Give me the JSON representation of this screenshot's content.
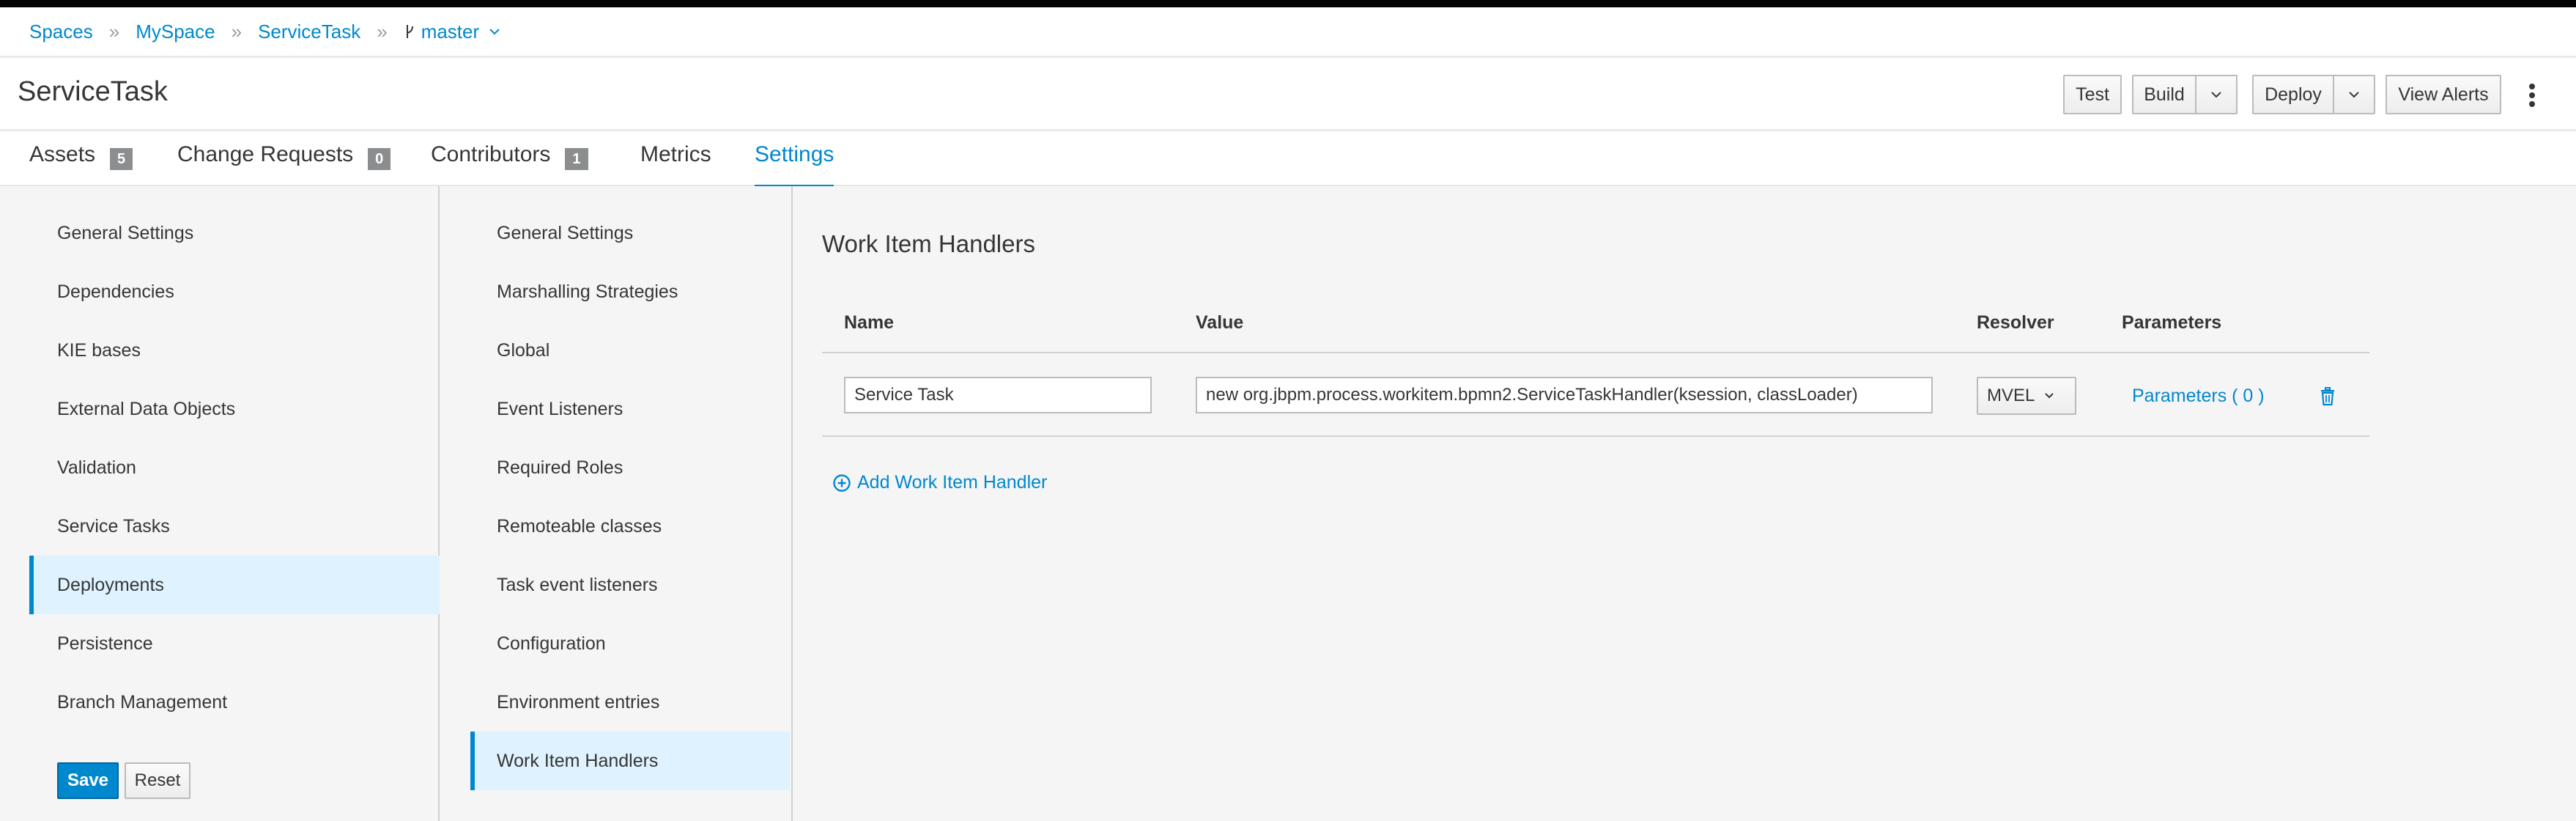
{
  "breadcrumb": {
    "spaces": "Spaces",
    "myspace": "MySpace",
    "project": "ServiceTask",
    "branch": "master",
    "separator": "»"
  },
  "header": {
    "title": "ServiceTask",
    "buttons": {
      "test": "Test",
      "build": "Build",
      "deploy": "Deploy",
      "view_alerts": "View Alerts"
    }
  },
  "tabs": [
    {
      "label": "Assets",
      "count": "5"
    },
    {
      "label": "Change Requests",
      "count": "0"
    },
    {
      "label": "Contributors",
      "count": "1"
    },
    {
      "label": "Metrics"
    },
    {
      "label": "Settings",
      "active": true
    }
  ],
  "settings_nav": {
    "items": [
      "General Settings",
      "Dependencies",
      "KIE bases",
      "External Data Objects",
      "Validation",
      "Service Tasks",
      "Deployments",
      "Persistence",
      "Branch Management"
    ],
    "selected": "Deployments",
    "save_label": "Save",
    "reset_label": "Reset"
  },
  "deployments_nav": {
    "items": [
      "General Settings",
      "Marshalling Strategies",
      "Global",
      "Event Listeners",
      "Required Roles",
      "Remoteable classes",
      "Task event listeners",
      "Configuration",
      "Environment entries",
      "Work Item Handlers"
    ],
    "selected": "Work Item Handlers"
  },
  "work_item_handlers": {
    "title": "Work Item Handlers",
    "columns": {
      "name": "Name",
      "value": "Value",
      "resolver": "Resolver",
      "parameters": "Parameters"
    },
    "rows": [
      {
        "name": "Service Task",
        "value": "new org.jbpm.process.workitem.bpmn2.ServiceTaskHandler(ksession, classLoader)",
        "resolver": "MVEL",
        "parameters": "Parameters ( 0 )"
      }
    ],
    "add_label": "Add Work Item Handler"
  },
  "colors": {
    "accent": "#0088ce",
    "selected_bg": "#def3ff",
    "badge": "#8b8d8f"
  }
}
